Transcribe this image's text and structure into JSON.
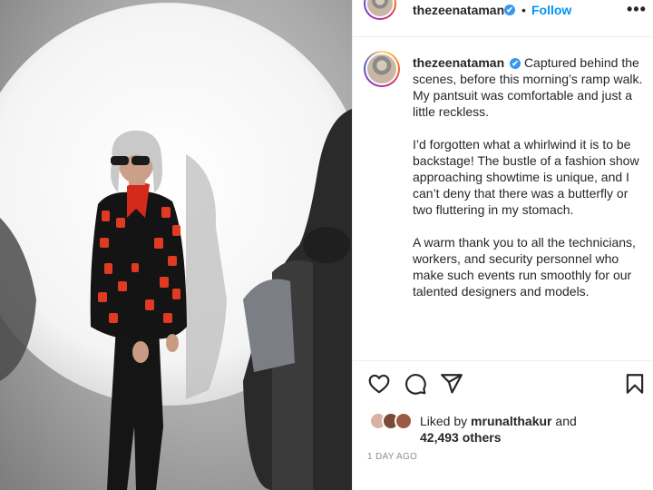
{
  "post": {
    "username": "thezeenataman",
    "verified_mark": "✔",
    "follow_label": "Follow",
    "separator": "•",
    "more_label": "•••",
    "caption_paragraphs": [
      "Captured behind the scenes, before this morning’s ramp walk. My pantsuit was comfortable and just a little reckless.",
      "I’d forgotten what a whirlwind it is to be backstage! The bustle of a fashion show approaching showtime is unique, and I can’t deny that there was a butterfly or two fluttering in my stomach.",
      "A warm thank you to all the technicians, workers, and security personnel who make such events run smoothly for our talented designers and models."
    ],
    "actions": {
      "like_icon": "heart-outline-icon",
      "comment_icon": "comment-bubble-icon",
      "share_icon": "paper-plane-icon",
      "save_icon": "bookmark-icon"
    },
    "likes": {
      "prefix": "Liked by",
      "user": "mrunalthakur",
      "middle": "and",
      "count_text": "42,493 others"
    },
    "timestamp": "1 DAY AGO"
  },
  "colors": {
    "link_blue": "#0095f6",
    "verified_blue": "#3897f0",
    "text": "#262626",
    "muted": "#8e8e8e"
  }
}
